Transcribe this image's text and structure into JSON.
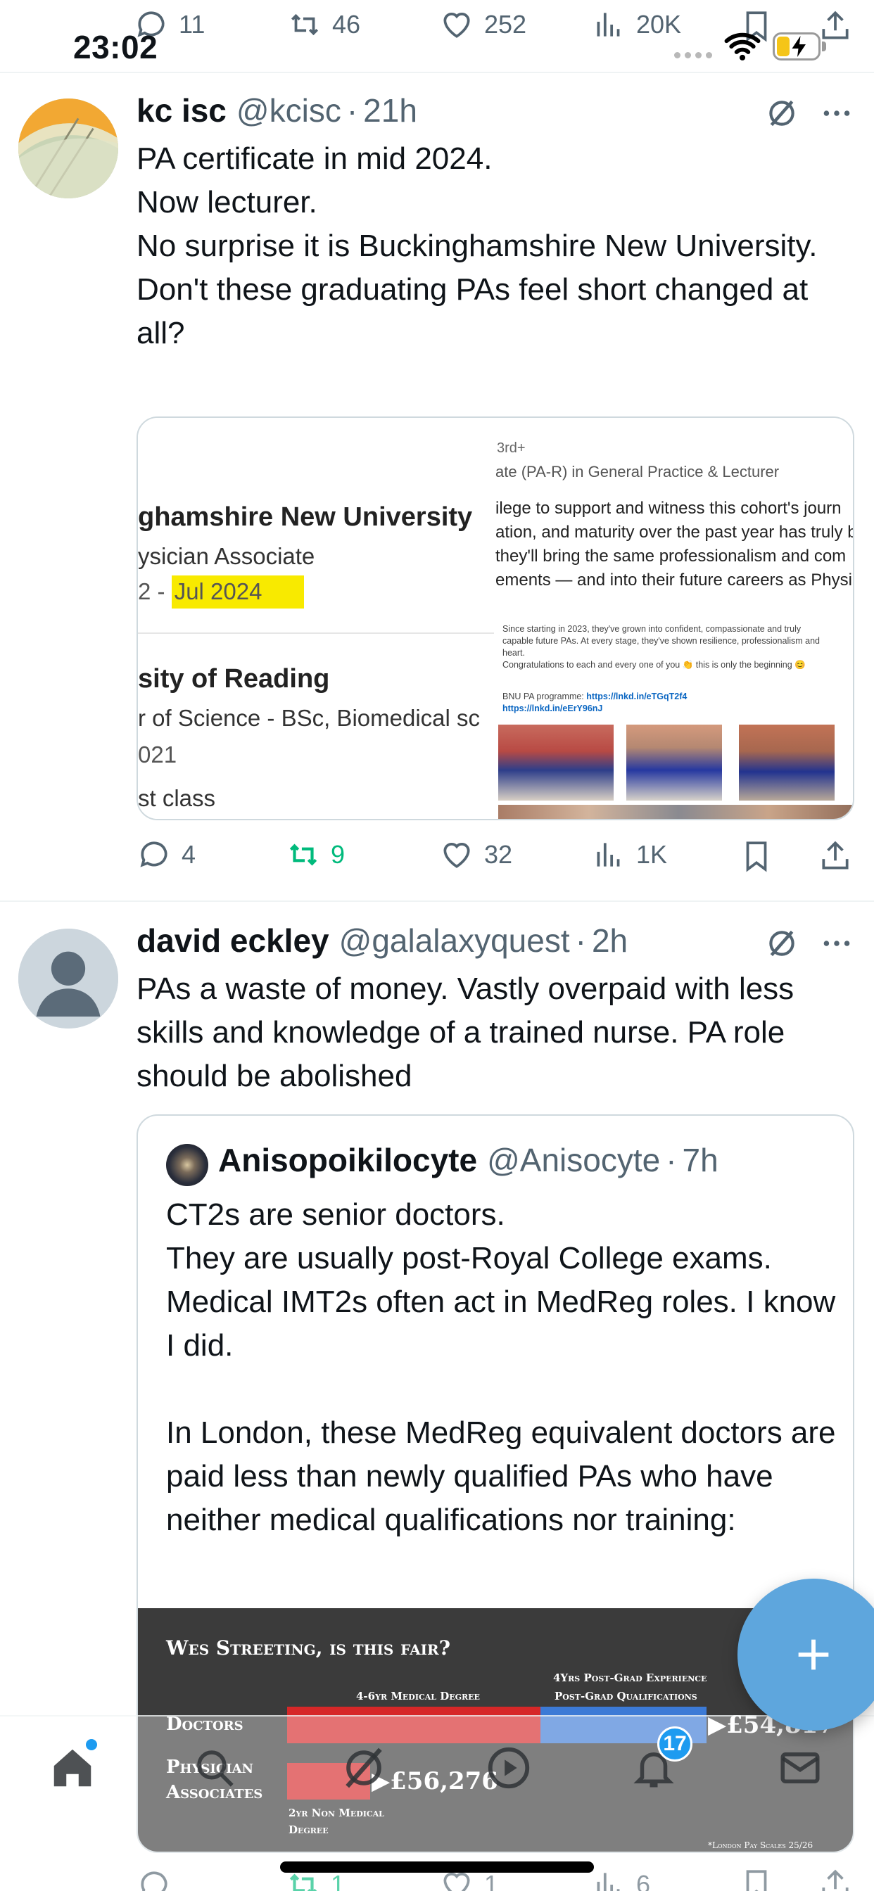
{
  "status_bar": {
    "time": "23:02"
  },
  "top_metrics": {
    "replies": "11",
    "reposts": "46",
    "likes": "252",
    "views": "20K"
  },
  "tweet1": {
    "name": "kc isc",
    "handle": "@kcisc",
    "time": "21h",
    "text": "PA certificate in mid 2024.\nNow lecturer.\nNo surprise it is Buckinghamshire New University.\nDon't these graduating PAs feel short changed at all?",
    "media": {
      "left": {
        "school1": "ghamshire New University",
        "degree1": "ysician Associate",
        "dates1_prefix": "2 - ",
        "dates1_highlight": "Jul 2024",
        "school2": "sity of Reading",
        "degree2": "r of Science - BSc, Biomedical sc",
        "year2": "021",
        "grade2": "st class"
      },
      "right": {
        "connection": "3rd+",
        "title": "ate (PA-R) in General Practice & Lecturer",
        "para_lines": [
          "ilege to support and witness this cohort's journ",
          "ation, and maturity over the past year has truly b",
          " they'll bring the same professionalism and com",
          "ements — and into their future careers as Physi"
        ],
        "small_lines": [
          "Since starting in 2023, they've grown into confident, compassionate and truly",
          "capable future PAs. At every stage, they've shown resilience, professionalism and",
          "heart.",
          "Congratulations to each and every one of you 👏 this is only the beginning 😊"
        ],
        "programme_label": "BNU PA programme:",
        "link1": "https://lnkd.in/eTGqT2f4",
        "link2": "https://lnkd.in/eErY96nJ"
      }
    },
    "metrics": {
      "replies": "4",
      "reposts": "9",
      "likes": "32",
      "views": "1K"
    }
  },
  "tweet2": {
    "name": "david eckley",
    "handle": "@galalaxyquest",
    "time": "2h",
    "text": "PAs a waste of money. Vastly overpaid with less skills and knowledge of a trained nurse. PA role should be abolished",
    "quote": {
      "name": "Anisopoikilocyte",
      "handle": "@Anisocyte",
      "time": "7h",
      "text": "CT2s are senior doctors.\nThey are usually post-Royal College exams.\nMedical IMT2s often act in MedReg roles. I know I did.\n\nIn London, these MedReg equivalent doctors are paid less than newly qualified PAs who have neither medical qualifications nor training:"
    },
    "metrics": {
      "replies": "",
      "reposts": "1",
      "likes": "1",
      "views": "6"
    }
  },
  "chart_data": {
    "type": "bar",
    "title": "Wes Streeting, is this fair?",
    "categories": [
      "Doctors",
      "Physician Associates"
    ],
    "segment_labels": {
      "medical_degree": "4-6yr Medical Degree",
      "postgrad_line1": "4Yrs Post-Grad Experience",
      "postgrad_line2": "Post-Grad Qualifications",
      "non_medical_line1": "2yr Non Medical",
      "non_medical_line2": "Degree"
    },
    "values": [
      "▶£54,817",
      "▶£56,276"
    ],
    "footnote": "*London Pay Scales 25/26",
    "colors": {
      "medical_degree": "#d62728",
      "postgrad": "#3c7ad6",
      "non_medical": "#d62728",
      "background": "#3b3b3b"
    }
  },
  "tab_bar": {
    "notification_count": "17"
  },
  "icons": {
    "reply": "speech-bubble-icon",
    "repost": "repost-arrows-icon",
    "like": "heart-icon",
    "views": "bar-chart-icon",
    "bookmark": "bookmark-icon",
    "share": "share-upload-icon",
    "grok": "grok-slash-circle-icon",
    "more": "more-dots-icon",
    "compose": "plus-icon"
  }
}
